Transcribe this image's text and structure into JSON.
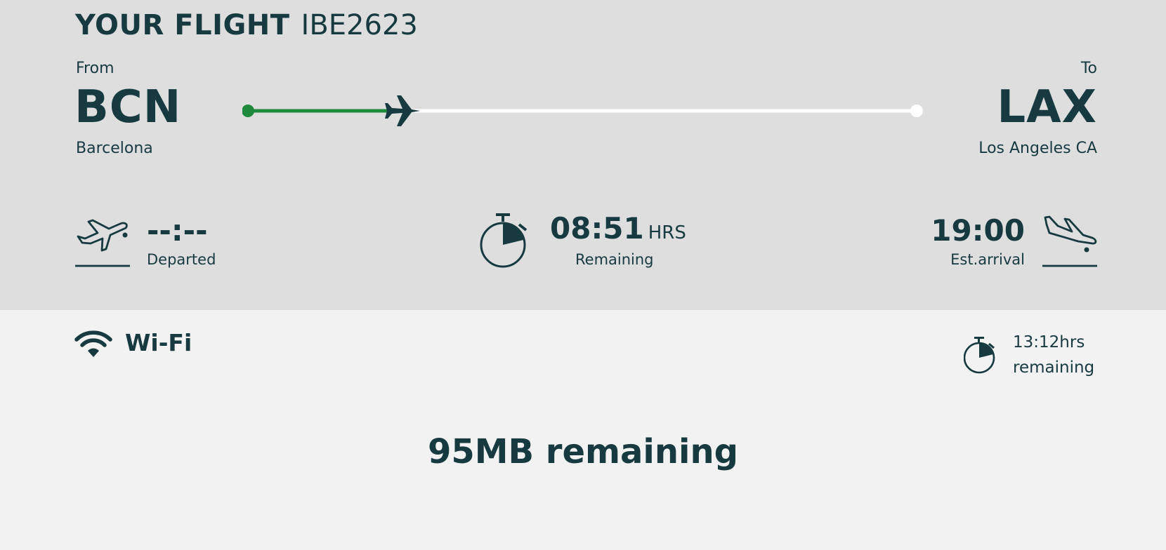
{
  "header": {
    "title": "YOUR FLIGHT",
    "flight_number": "IBE2623"
  },
  "origin": {
    "label": "From",
    "code": "BCN",
    "city": "Barcelona"
  },
  "destination": {
    "label": "To",
    "code": "LAX",
    "city": "Los Angeles CA"
  },
  "route": {
    "progress": 0.22,
    "color_flown": "#1e8a3c",
    "color_remaining": "#ffffff"
  },
  "departed": {
    "time": "--:--",
    "label": "Departed",
    "icon": "takeoff-icon"
  },
  "remaining": {
    "time": "08:51",
    "unit": "HRS",
    "label": "Remaining",
    "icon": "stopwatch-icon"
  },
  "arrival": {
    "time": "19:00",
    "label": "Est.arrival",
    "icon": "landing-icon"
  },
  "wifi": {
    "title": "Wi-Fi",
    "icon": "wifi-icon",
    "time_remaining": "13:12hrs",
    "time_label": "remaining",
    "data_remaining": "95MB remaining"
  },
  "colors": {
    "text": "#163a40",
    "top_bg": "#dedede",
    "bottom_bg": "#f2f2f2"
  }
}
